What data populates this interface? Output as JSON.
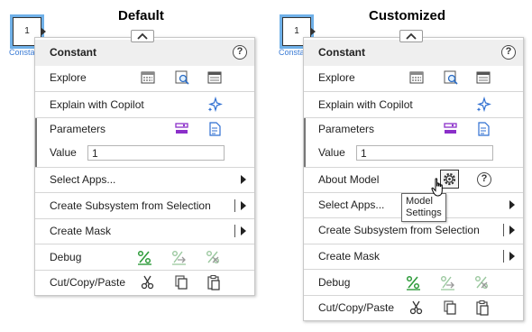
{
  "headings": {
    "default": "Default",
    "customized": "Customized"
  },
  "block": {
    "value": "1",
    "label": "Constant"
  },
  "menu": {
    "title": "Constant",
    "help_icon": "?",
    "explore": "Explore",
    "explain": "Explain with Copilot",
    "parameters": "Parameters",
    "value_label": "Value",
    "value": "1",
    "about_model": "About Model",
    "select_apps": "Select Apps...",
    "create_subsystem": "Create Subsystem from Selection",
    "create_mask": "Create Mask",
    "debug": "Debug",
    "cut_copy_paste": "Cut/Copy/Paste"
  },
  "tooltip": {
    "line1": "Model",
    "line2": "Settings"
  },
  "icons": [
    "collapse-chevron-up-icon",
    "help-icon",
    "block-explorer-icon",
    "zoom-icon",
    "model-browser-icon",
    "copilot-sparkle-icon",
    "parameters-icon",
    "document-icon",
    "gear-icon",
    "submenu-arrow-icon",
    "debug-percent-icon",
    "debug-step-icon",
    "debug-clear-icon",
    "scissors-icon",
    "copy-icon",
    "paste-icon",
    "hand-cursor-icon"
  ],
  "colors": {
    "accent_blue": "#3a7bd5",
    "purple": "#8b2fc9",
    "green": "#2e9b3a",
    "header_bg": "#efefef"
  }
}
